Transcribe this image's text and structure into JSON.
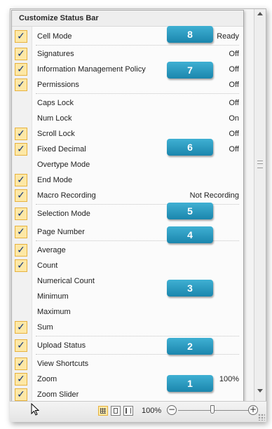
{
  "menu": {
    "title": "Customize Status Bar",
    "items": [
      {
        "label": "Cell Mode",
        "value": "Ready",
        "checked": true
      },
      {
        "label": "Signatures",
        "value": "Off",
        "checked": true
      },
      {
        "label": "Information Management Policy",
        "value": "Off",
        "checked": true
      },
      {
        "label": "Permissions",
        "value": "Off",
        "checked": true
      },
      {
        "label": "Caps Lock",
        "value": "Off",
        "checked": false
      },
      {
        "label": "Num Lock",
        "value": "On",
        "checked": false
      },
      {
        "label": "Scroll Lock",
        "value": "Off",
        "checked": true
      },
      {
        "label": "Fixed Decimal",
        "value": "Off",
        "checked": true
      },
      {
        "label": "Overtype Mode",
        "value": "",
        "checked": false
      },
      {
        "label": "End Mode",
        "value": "",
        "checked": true
      },
      {
        "label": "Macro Recording",
        "value": "Not Recording",
        "checked": true
      },
      {
        "label": "Selection Mode",
        "value": "",
        "checked": true
      },
      {
        "label": "Page Number",
        "value": "",
        "checked": true
      },
      {
        "label": "Average",
        "value": "",
        "checked": true
      },
      {
        "label": "Count",
        "value": "",
        "checked": true
      },
      {
        "label": "Numerical Count",
        "value": "",
        "checked": false
      },
      {
        "label": "Minimum",
        "value": "",
        "checked": false
      },
      {
        "label": "Maximum",
        "value": "",
        "checked": false
      },
      {
        "label": "Sum",
        "value": "",
        "checked": true
      },
      {
        "label": "Upload Status",
        "value": "",
        "checked": true
      },
      {
        "label": "View Shortcuts",
        "value": "",
        "checked": true
      },
      {
        "label": "Zoom",
        "value": "100%",
        "checked": true
      },
      {
        "label": "Zoom Slider",
        "value": "",
        "checked": true
      }
    ],
    "check_glyph": "✓"
  },
  "callouts": [
    "8",
    "7",
    "6",
    "5",
    "4",
    "3",
    "2",
    "1"
  ],
  "statusbar": {
    "zoom_level": "100%",
    "zoom_minus": "−",
    "zoom_plus": "+",
    "active_view": "normal"
  },
  "colors": {
    "check_fill": "#fde8a6",
    "check_border": "#e7b23f",
    "callout": "#2a9cc4"
  }
}
